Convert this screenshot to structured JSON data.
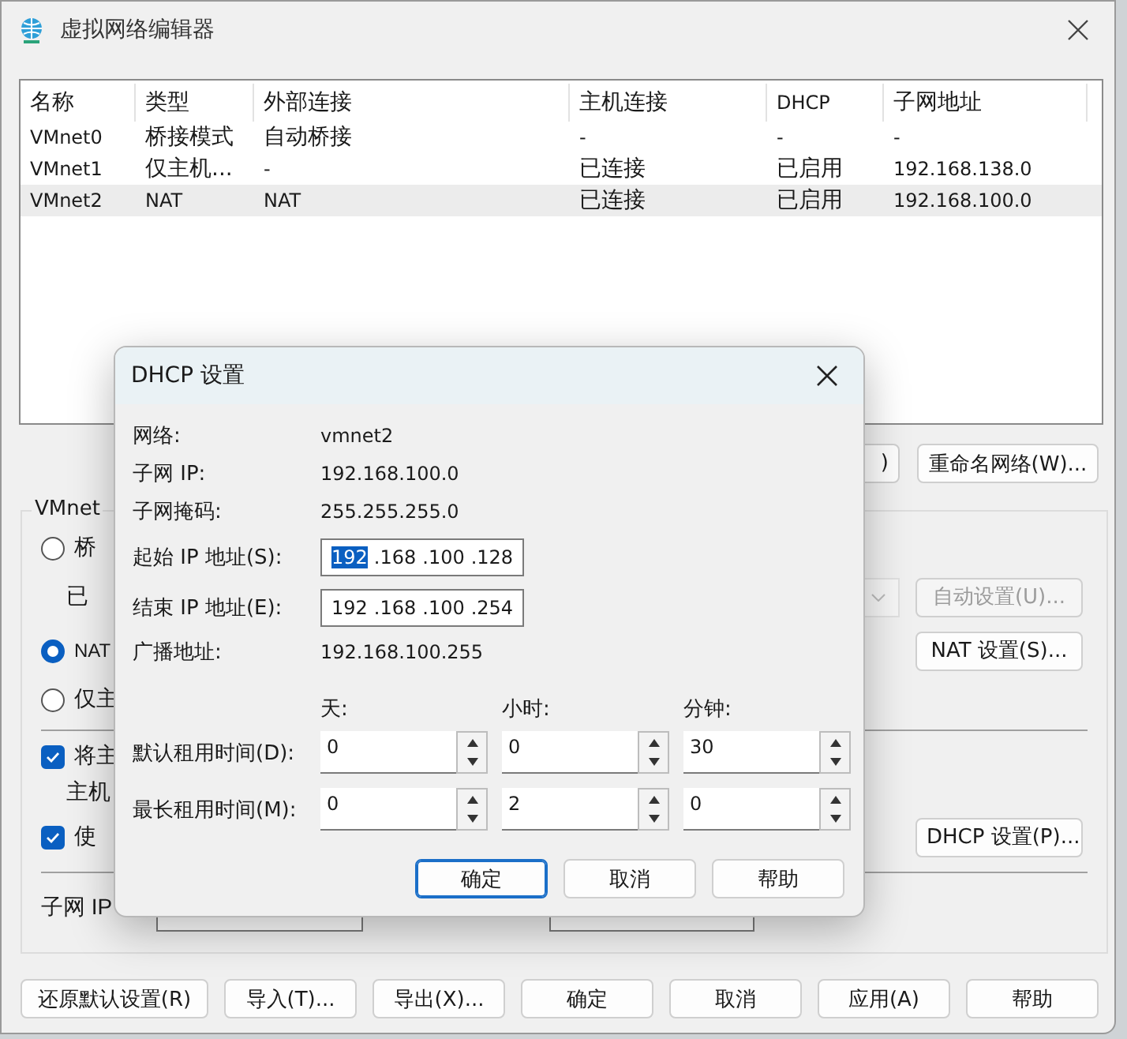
{
  "window": {
    "title": "虚拟网络编辑器"
  },
  "network_table": {
    "columns": [
      "名称",
      "类型",
      "外部连接",
      "主机连接",
      "DHCP",
      "子网地址"
    ],
    "rows": [
      {
        "cells": [
          "VMnet0",
          "桥接模式",
          "自动桥接",
          "-",
          "-",
          "-"
        ],
        "selected": false
      },
      {
        "cells": [
          "VMnet1",
          "仅主机...",
          "-",
          "已连接",
          "已启用",
          "192.168.138.0"
        ],
        "selected": false
      },
      {
        "cells": [
          "VMnet2",
          "NAT",
          "NAT",
          "已连接",
          "已启用",
          "192.168.100.0"
        ],
        "selected": true
      }
    ]
  },
  "table_buttons": [
    {
      "label": ")"
    },
    {
      "label": "重命名网络(W)..."
    }
  ],
  "vmnet_info": {
    "legend": "VMnet",
    "rows": [
      {
        "kind": "radio",
        "label": "桥",
        "selected": false
      },
      {
        "kind": "text",
        "label": "已",
        "dropdown": {
          "disabled": true
        },
        "button": {
          "label": "自动设置(U)...",
          "disabled": true
        }
      },
      {
        "kind": "radio",
        "label": "NAT",
        "selected": true,
        "button": {
          "label": "NAT 设置(S)...",
          "disabled": false
        }
      },
      {
        "kind": "radio",
        "label": "仅主",
        "selected": false
      },
      {
        "kind": "divider"
      },
      {
        "kind": "checkbox",
        "label": "将主",
        "checked": true
      },
      {
        "kind": "text",
        "label": "主机"
      },
      {
        "kind": "checkbox",
        "label": "使",
        "checked": true,
        "button": {
          "label": "DHCP 设置(P)...",
          "disabled": false
        }
      },
      {
        "kind": "divider"
      },
      {
        "kind": "fields",
        "label": "子网 IP"
      }
    ]
  },
  "bottom_buttons": [
    {
      "label": "还原默认设置(R)"
    },
    {
      "label": "导入(T)..."
    },
    {
      "label": "导出(X)..."
    },
    {
      "label": "确定"
    },
    {
      "label": "取消"
    },
    {
      "label": "应用(A)"
    },
    {
      "label": "帮助"
    }
  ],
  "dhcp_dialog": {
    "title": "DHCP 设置",
    "info": [
      {
        "label": "网络:",
        "value": "vmnet2"
      },
      {
        "label": "子网 IP:",
        "value": "192.168.100.0"
      },
      {
        "label": "子网掩码:",
        "value": "255.255.255.0"
      }
    ],
    "ranges": [
      {
        "label": "起始 IP 地址(S):",
        "parts": [
          {
            "text": "192",
            "selected": true
          },
          {
            "text": ".168",
            "selected": false
          },
          {
            "text": ".100",
            "selected": false
          },
          {
            "text": ".128",
            "selected": false
          }
        ]
      },
      {
        "label": "结束 IP 地址(E):",
        "parts": [
          {
            "text": "192",
            "selected": false
          },
          {
            "text": ".168",
            "selected": false
          },
          {
            "text": ".100",
            "selected": false
          },
          {
            "text": ".254",
            "selected": false
          }
        ]
      }
    ],
    "broadcast": {
      "label": "广播地址:",
      "value": "192.168.100.255"
    },
    "lease_headers": [
      "天:",
      "小时:",
      "分钟:"
    ],
    "leases": [
      {
        "label": "默认租用时间(D):",
        "values": [
          "0",
          "0",
          "30"
        ]
      },
      {
        "label": "最长租用时间(M):",
        "values": [
          "0",
          "2",
          "0"
        ]
      }
    ],
    "buttons": [
      {
        "label": "确定",
        "default": true
      },
      {
        "label": "取消",
        "default": false
      },
      {
        "label": "帮助",
        "default": false
      }
    ]
  }
}
